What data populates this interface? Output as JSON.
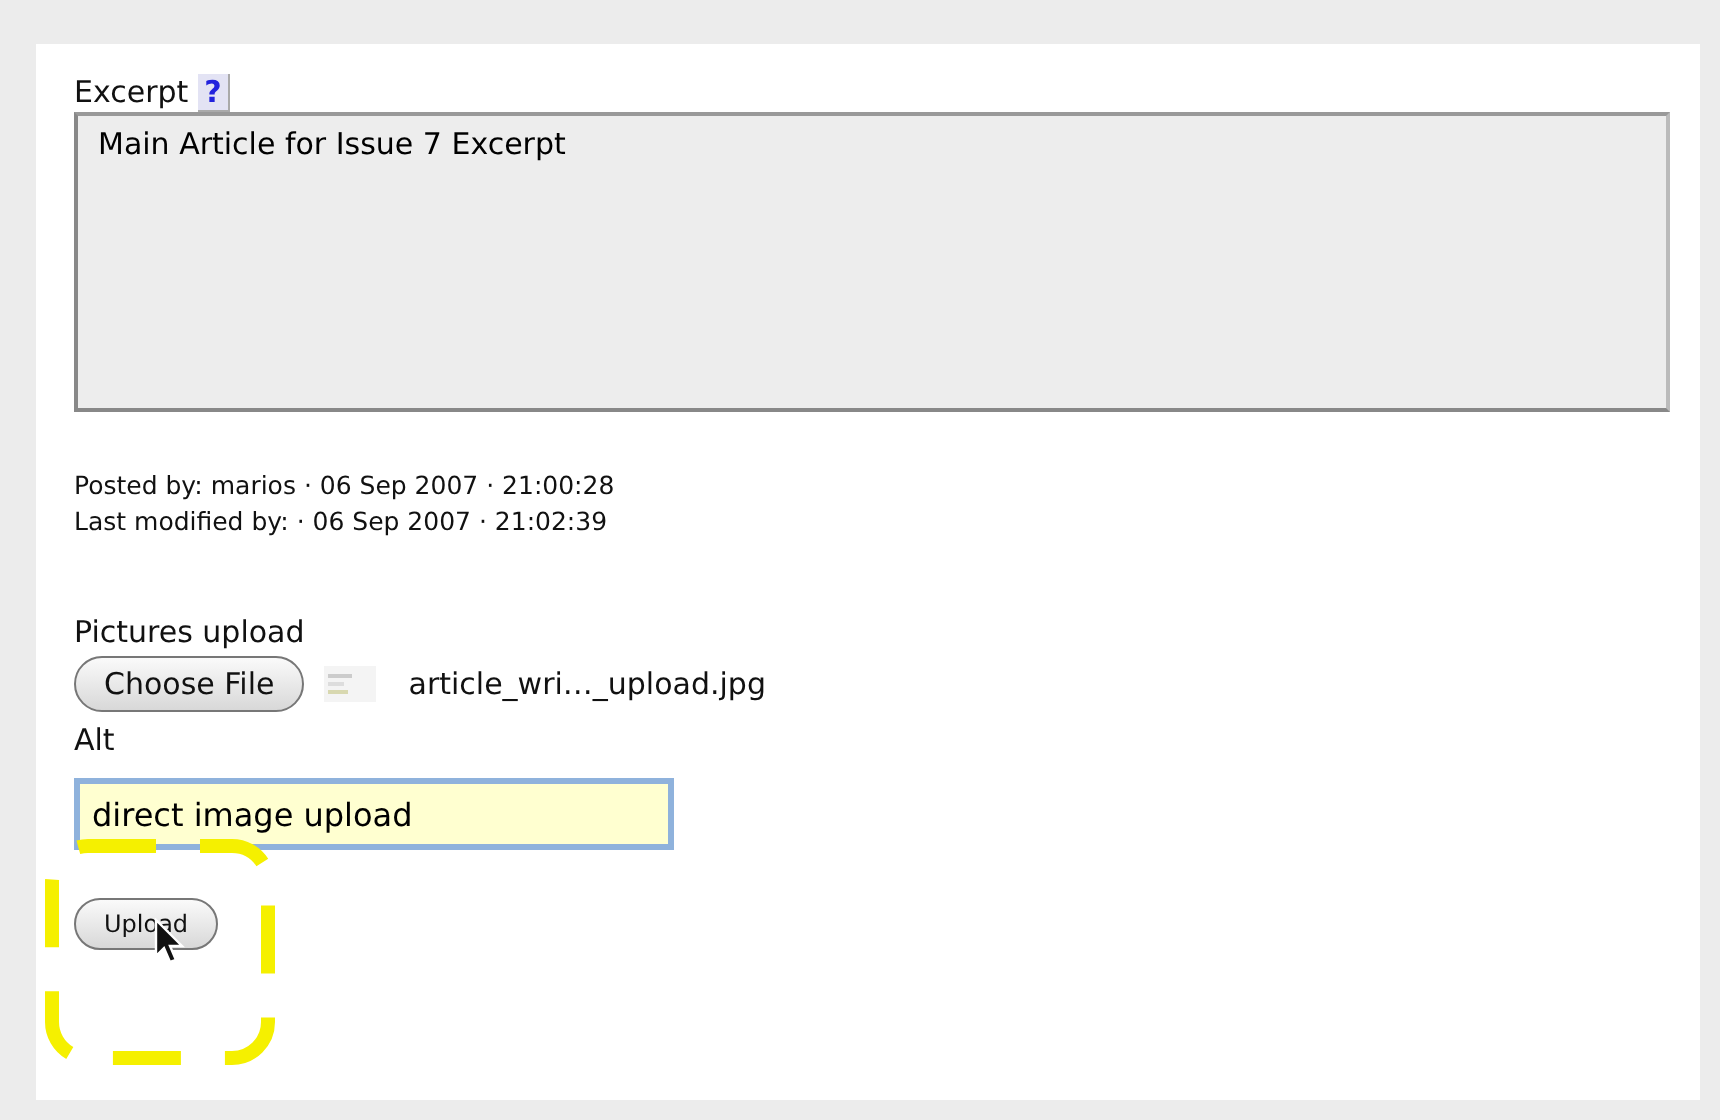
{
  "excerpt": {
    "label": "Excerpt",
    "help": "?",
    "value": "Main Article for Issue 7 Excerpt"
  },
  "meta": [
    "Posted by: marios · 06 Sep 2007 · 21:00:28",
    "Last modified by: · 06 Sep 2007 · 21:02:39"
  ],
  "upload": {
    "label": "Pictures upload",
    "choose_button": "Choose File",
    "file_name": "article_wri…_upload.jpg",
    "alt_label": "Alt",
    "alt_value": "direct image upload",
    "submit_button": "Upload"
  }
}
